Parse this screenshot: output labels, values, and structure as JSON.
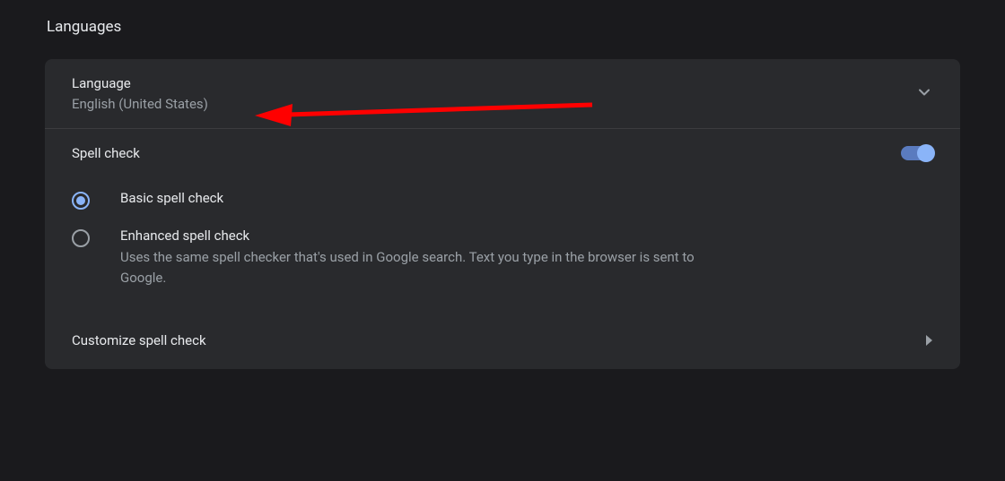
{
  "header": {
    "title": "Languages"
  },
  "language": {
    "label": "Language",
    "value": "English (United States)"
  },
  "spellcheck": {
    "title": "Spell check",
    "enabled": true,
    "options": {
      "basic": {
        "label": "Basic spell check"
      },
      "enhanced": {
        "label": "Enhanced spell check",
        "description": "Uses the same spell checker that's used in Google search. Text you type in the browser is sent to Google."
      }
    },
    "selected": "basic",
    "customize_label": "Customize spell check"
  },
  "annotation": {
    "arrow_color": "#ff0000"
  }
}
